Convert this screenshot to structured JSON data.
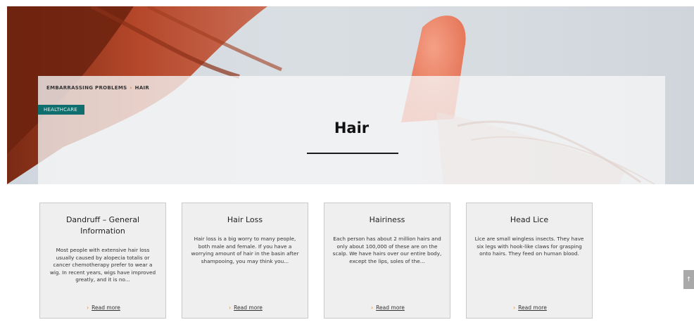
{
  "hero": {
    "breadcrumb": [
      "EMBARRASSING PROBLEMS",
      "HAIR"
    ],
    "breadcrumb_separator": "›",
    "tag": "HEALTHCARE",
    "title": "Hair"
  },
  "cards": [
    {
      "title": "Dandruff – General Information",
      "text": "Most people with extensive hair loss usually caused by alopecia totalis or cancer chemotherapy prefer to wear a wig. In recent years, wigs have improved greatly, and it is no...",
      "link": "Read more"
    },
    {
      "title": "Hair Loss",
      "text": "Hair loss is a big worry to many people, both male and female. If you have a worrying amount of hair in the basin after shampooing, you may think you...",
      "link": "Read more"
    },
    {
      "title": "Hairiness",
      "text": "Each person has about 2 million hairs and only about 100,000 of these are on the scalp. We have hairs over our entire body, except the lips, soles of the...",
      "link": "Read more"
    },
    {
      "title": "Head Lice",
      "text": "Lice are small wingless insects. They have six legs with hook-like claws for grasping onto hairs. They feed on human blood.",
      "link": "Read more"
    }
  ],
  "icons": {
    "read_more": "chevron-right-icon",
    "scroll_top": "arrow-up-icon"
  },
  "colors": {
    "accent": "#e07a16",
    "tag_bg": "#0f6e6e",
    "card_bg": "#efefef"
  }
}
